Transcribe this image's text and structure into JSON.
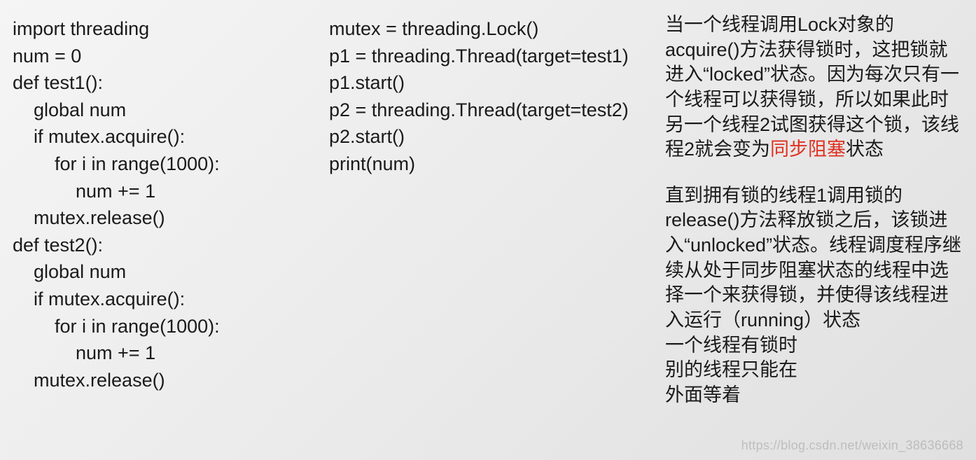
{
  "col1": {
    "lines": [
      "import threading",
      "num = 0",
      "def test1():",
      "    global num",
      "    if mutex.acquire():",
      "        for i in range(1000):",
      "            num += 1",
      "    mutex.release()",
      "def test2():",
      "    global num",
      "    if mutex.acquire():",
      "        for i in range(1000):",
      "            num += 1",
      "    mutex.release()"
    ]
  },
  "col2": {
    "lines": [
      "mutex = threading.Lock()",
      "p1 = threading.Thread(target=test1)",
      "p1.start()",
      "p2 = threading.Thread(target=test2)",
      "p2.start()",
      "print(num)"
    ]
  },
  "col3": {
    "para1_pre": "当一个线程调用Lock对象的acquire()方法获得锁时，这把锁就进入“locked”状态。因为每次只有一个线程可以获得锁，所以如果此时另一个线程2试图获得这个锁，该线程2就会变为",
    "para1_hl": "同步阻塞",
    "para1_post": "状态",
    "para2": "直到拥有锁的线程1调用锁的release()方法释放锁之后，该锁进入“unlocked”状态。线程调度程序继续从处于同步阻塞状态的线程中选择一个来获得锁，并使得该线程进入运行（running）状态",
    "para3_l1": "一个线程有锁时",
    "para3_l2": "别的线程只能在",
    "para3_l3": "外面等着"
  },
  "watermark": "https://blog.csdn.net/weixin_38636668"
}
